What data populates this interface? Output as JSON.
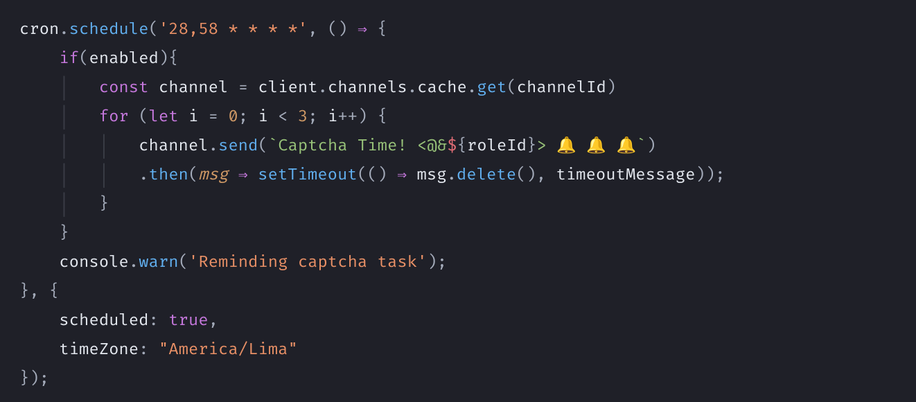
{
  "code": {
    "cron_expr": "'28,58 * * * *'",
    "if_cond": "enabled",
    "channel_decl_kw": "const",
    "channel_name": "channel",
    "client_ident": "client",
    "channels_ident": "channels",
    "cache_ident": "cache",
    "get_ident": "get",
    "channel_id": "channelId",
    "for_kw": "for",
    "let_kw": "let",
    "i_ident": "i",
    "loop_start": "0",
    "loop_end": "3",
    "send_ident": "send",
    "template_literal": "Captcha Time! <@&",
    "template_var": "roleId",
    "template_tail": "> 🔔 🔔 🔔",
    "then_ident": "then",
    "msg_param": "msg",
    "settimeout": "setTimeout",
    "msg_delete_obj": "msg",
    "delete_ident": "delete",
    "timeout_var": "timeoutMessage",
    "console_ident": "console",
    "warn_ident": "warn",
    "warn_msg": "'Reminding captcha task'",
    "scheduled_key": "scheduled",
    "scheduled_val": "true",
    "tz_key": "timeZone",
    "tz_val": "\"America/Lima\""
  }
}
